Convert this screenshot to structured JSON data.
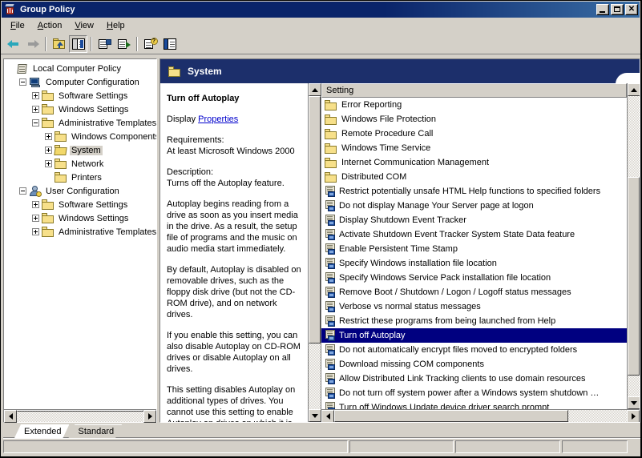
{
  "window": {
    "title": "Group Policy",
    "icon": "group-policy-icon",
    "controls": {
      "minimize": "_",
      "maximize": "□",
      "close": "✕"
    }
  },
  "menubar": {
    "items": [
      {
        "label": "File",
        "accel": "F"
      },
      {
        "label": "Action",
        "accel": "A"
      },
      {
        "label": "View",
        "accel": "V"
      },
      {
        "label": "Help",
        "accel": "H"
      }
    ]
  },
  "toolbar": {
    "buttons": [
      {
        "name": "back-arrow-icon",
        "title": "Back"
      },
      {
        "name": "forward-arrow-icon",
        "title": "Forward"
      },
      {
        "name": "up-one-level-icon",
        "title": "Up One Level"
      },
      {
        "name": "show-hide-tree-icon",
        "title": "Show/Hide Console Tree",
        "pressed": true
      },
      {
        "name": "properties-icon",
        "title": "Properties"
      },
      {
        "name": "export-list-icon",
        "title": "Export List"
      },
      {
        "name": "help-icon",
        "title": "Help"
      },
      {
        "name": "show-pane-icon",
        "title": "Show/Hide Pane"
      }
    ]
  },
  "tree": {
    "nodes": [
      {
        "label": "Local Computer Policy",
        "icon": "policy-icon",
        "depth": 0,
        "expander": "none"
      },
      {
        "label": "Computer Configuration",
        "icon": "computer-icon",
        "depth": 1,
        "expander": "minus"
      },
      {
        "label": "Software Settings",
        "icon": "folder-icon",
        "depth": 2,
        "expander": "plus"
      },
      {
        "label": "Windows Settings",
        "icon": "folder-icon",
        "depth": 2,
        "expander": "plus"
      },
      {
        "label": "Administrative Templates",
        "icon": "folder-icon",
        "depth": 2,
        "expander": "minus"
      },
      {
        "label": "Windows Components",
        "icon": "folder-icon",
        "depth": 3,
        "expander": "plus"
      },
      {
        "label": "System",
        "icon": "folder-open-icon",
        "depth": 3,
        "expander": "plus",
        "selected": true
      },
      {
        "label": "Network",
        "icon": "folder-icon",
        "depth": 3,
        "expander": "plus"
      },
      {
        "label": "Printers",
        "icon": "folder-icon",
        "depth": 3,
        "expander": "none"
      },
      {
        "label": "User Configuration",
        "icon": "user-icon",
        "depth": 1,
        "expander": "minus"
      },
      {
        "label": "Software Settings",
        "icon": "folder-icon",
        "depth": 2,
        "expander": "plus"
      },
      {
        "label": "Windows Settings",
        "icon": "folder-icon",
        "depth": 2,
        "expander": "plus"
      },
      {
        "label": "Administrative Templates",
        "icon": "folder-icon",
        "depth": 2,
        "expander": "plus"
      }
    ]
  },
  "banner": {
    "title": "System",
    "icon": "folder-icon"
  },
  "description": {
    "title": "Turn off Autoplay",
    "display_label": "Display",
    "display_link": "Properties",
    "requirements_label": "Requirements:",
    "requirements_value": "At least Microsoft Windows 2000",
    "description_label": "Description:",
    "description_value": "Turns off the Autoplay feature.",
    "paragraphs": [
      "Autoplay begins reading from a drive as soon as you insert media in the drive. As a result, the setup file of programs and the music on audio media start immediately.",
      "By default, Autoplay is disabled on removable drives, such as the floppy disk drive (but not the CD-ROM drive), and on network drives.",
      "If you enable this setting, you can also disable Autoplay on CD-ROM drives or disable Autoplay on all drives.",
      "This setting disables Autoplay on additional types of drives. You cannot use this setting to enable Autoplay on drives on which it is disabled by default."
    ]
  },
  "list": {
    "column_header": "Setting",
    "rows": [
      {
        "label": "Error Reporting",
        "icon": "folder-icon"
      },
      {
        "label": "Windows File Protection",
        "icon": "folder-icon"
      },
      {
        "label": "Remote Procedure Call",
        "icon": "folder-icon"
      },
      {
        "label": "Windows Time Service",
        "icon": "folder-icon"
      },
      {
        "label": "Internet Communication Management",
        "icon": "folder-icon"
      },
      {
        "label": "Distributed COM",
        "icon": "folder-icon"
      },
      {
        "label": "Restrict potentially unsafe HTML Help functions to specified folders",
        "icon": "policy-setting-icon"
      },
      {
        "label": "Do not display Manage Your Server page at logon",
        "icon": "policy-setting-icon"
      },
      {
        "label": "Display Shutdown Event Tracker",
        "icon": "policy-setting-icon"
      },
      {
        "label": "Activate Shutdown Event Tracker System State Data feature",
        "icon": "policy-setting-icon"
      },
      {
        "label": "Enable Persistent Time Stamp",
        "icon": "policy-setting-icon"
      },
      {
        "label": "Specify Windows installation file location",
        "icon": "policy-setting-icon"
      },
      {
        "label": "Specify Windows Service Pack installation file location",
        "icon": "policy-setting-icon"
      },
      {
        "label": "Remove Boot / Shutdown / Logon / Logoff status messages",
        "icon": "policy-setting-icon"
      },
      {
        "label": "Verbose vs normal status messages",
        "icon": "policy-setting-icon"
      },
      {
        "label": "Restrict these programs from being launched from Help",
        "icon": "policy-setting-icon"
      },
      {
        "label": "Turn off Autoplay",
        "icon": "policy-setting-icon",
        "selected": true
      },
      {
        "label": "Do not automatically encrypt files moved to encrypted folders",
        "icon": "policy-setting-icon"
      },
      {
        "label": "Download missing COM components",
        "icon": "policy-setting-icon"
      },
      {
        "label": "Allow Distributed Link Tracking clients to use domain resources",
        "icon": "policy-setting-icon"
      },
      {
        "label": "Do not turn off system power after a Windows system shutdown …",
        "icon": "policy-setting-icon"
      },
      {
        "label": "Turn off Windows Update device driver search prompt",
        "icon": "policy-setting-icon"
      }
    ]
  },
  "tabs": [
    {
      "label": "Extended",
      "active": true
    },
    {
      "label": "Standard",
      "active": false
    }
  ],
  "statusbar": {
    "panels": [
      "",
      "",
      "",
      ""
    ]
  },
  "colors": {
    "titlebar_start": "#0a246a",
    "titlebar_end": "#3a6ea5",
    "face": "#d4d0c8",
    "selection": "#000080",
    "banner": "#1c2f6b",
    "link": "#0000cc"
  }
}
